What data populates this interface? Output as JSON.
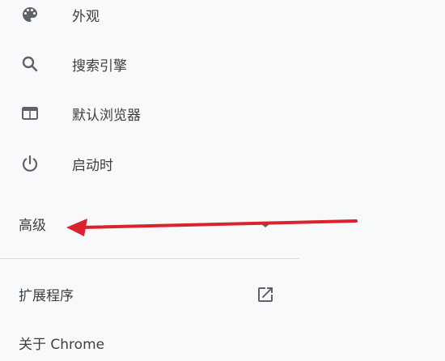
{
  "sidebar": {
    "items": [
      {
        "label": "外观",
        "icon": "palette-icon"
      },
      {
        "label": "搜索引擎",
        "icon": "search-icon"
      },
      {
        "label": "默认浏览器",
        "icon": "browser-window-icon"
      },
      {
        "label": "启动时",
        "icon": "power-icon"
      }
    ],
    "advanced": {
      "label": "高级",
      "icon": "chevron-down-icon"
    },
    "extensions": {
      "label": "扩展程序",
      "icon": "open-in-new-icon"
    },
    "about": {
      "label": "关于 Chrome"
    }
  },
  "annotation": {
    "arrow_color": "#d9232e"
  }
}
